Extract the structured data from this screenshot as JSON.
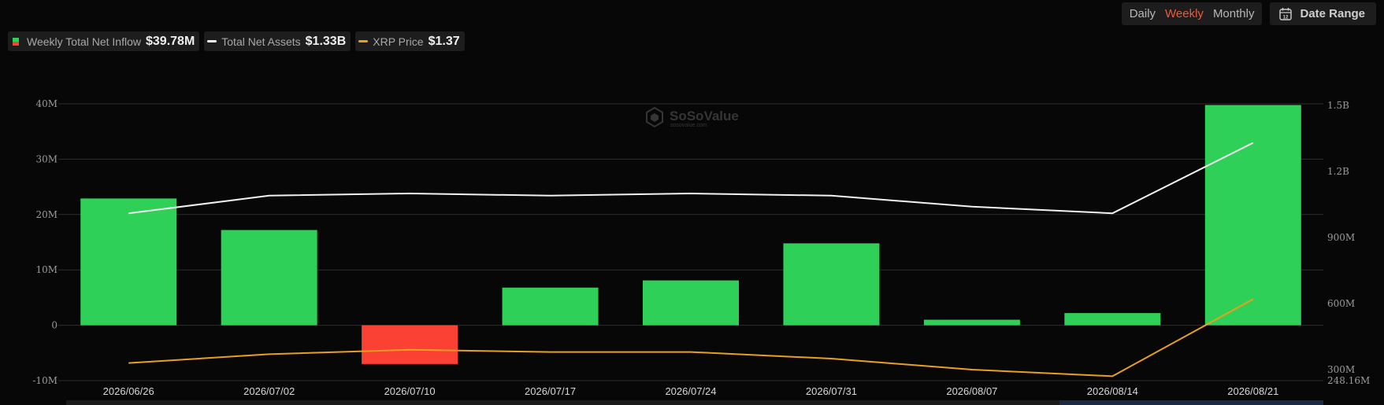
{
  "legend": {
    "inflow_label": "Weekly Total Net Inflow",
    "inflow_value": "$39.78M",
    "assets_label": "Total Net Assets",
    "assets_value": "$1.33B",
    "price_label": "XRP Price",
    "price_value": "$1.37"
  },
  "toolbar": {
    "daily": "Daily",
    "weekly": "Weekly",
    "monthly": "Monthly",
    "date_range": "Date Range",
    "calendar_day": "12"
  },
  "watermark": {
    "brand": "SoSoValue",
    "url": "sosovalue.com"
  },
  "colors": {
    "positive": "#2fd057",
    "negative": "#fb4034",
    "assets_line": "#f2f2f2",
    "price_line": "#e8a020",
    "active_tab": "#ef5a3c"
  },
  "chart_data": {
    "type": "bar",
    "categories": [
      "2026/06/26",
      "2026/07/02",
      "2026/07/10",
      "2026/07/17",
      "2026/07/24",
      "2026/07/31",
      "2026/08/07",
      "2026/08/14",
      "2026/08/21"
    ],
    "series": [
      {
        "name": "Weekly Total Net Inflow",
        "type": "bar",
        "axis": "left",
        "values": [
          22.9,
          17.2,
          -7.0,
          6.8,
          8.1,
          14.8,
          1.0,
          2.2,
          39.78
        ]
      },
      {
        "name": "Total Net Assets",
        "type": "line",
        "axis": "right",
        "values": [
          1.01,
          1.09,
          1.1,
          1.09,
          1.1,
          1.09,
          1.04,
          1.01,
          1.33
        ]
      },
      {
        "name": "XRP Price",
        "type": "line",
        "axis": "right",
        "values": [
          0.33,
          0.37,
          0.39,
          0.38,
          0.38,
          0.35,
          0.3,
          0.27,
          0.62
        ]
      }
    ],
    "left_axis": {
      "ticks": [
        40,
        30,
        20,
        10,
        0,
        -10
      ],
      "labels": [
        "40M",
        "30M",
        "20M",
        "10M",
        "0",
        "-10M"
      ],
      "range": [
        -10,
        40
      ]
    },
    "right_axis": {
      "ticks": [
        1.5,
        1.2,
        0.9,
        0.6,
        0.3,
        0.24816
      ],
      "labels": [
        "1.5B",
        "1.2B",
        "900M",
        "600M",
        "300M",
        "248.16M"
      ]
    },
    "grid": true
  }
}
